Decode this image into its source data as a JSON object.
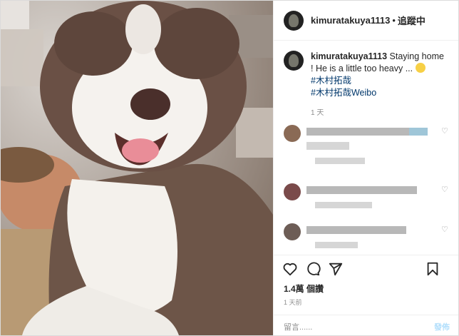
{
  "header": {
    "username": "kimuratakuya1113",
    "separator": "•",
    "follow_status": "追蹤中"
  },
  "caption": {
    "username": "kimuratakuya1113",
    "text": "Staying home ! He is a little too heavy ...",
    "hashtags": [
      "#木村拓哉",
      "#木村拓哉Weibo"
    ],
    "time": "1 天"
  },
  "icons": {
    "like": "heart-icon",
    "comment": "comment-icon",
    "share": "paper-plane-icon",
    "save": "bookmark-icon",
    "comment_like": "small-heart-icon"
  },
  "engagement": {
    "likes": "1.4萬 個讚",
    "time": "1 天前"
  },
  "comment_box": {
    "placeholder": "留言......",
    "post_label": "發佈"
  },
  "colors": {
    "link": "#00376b",
    "post_button": "#b2dffc"
  }
}
